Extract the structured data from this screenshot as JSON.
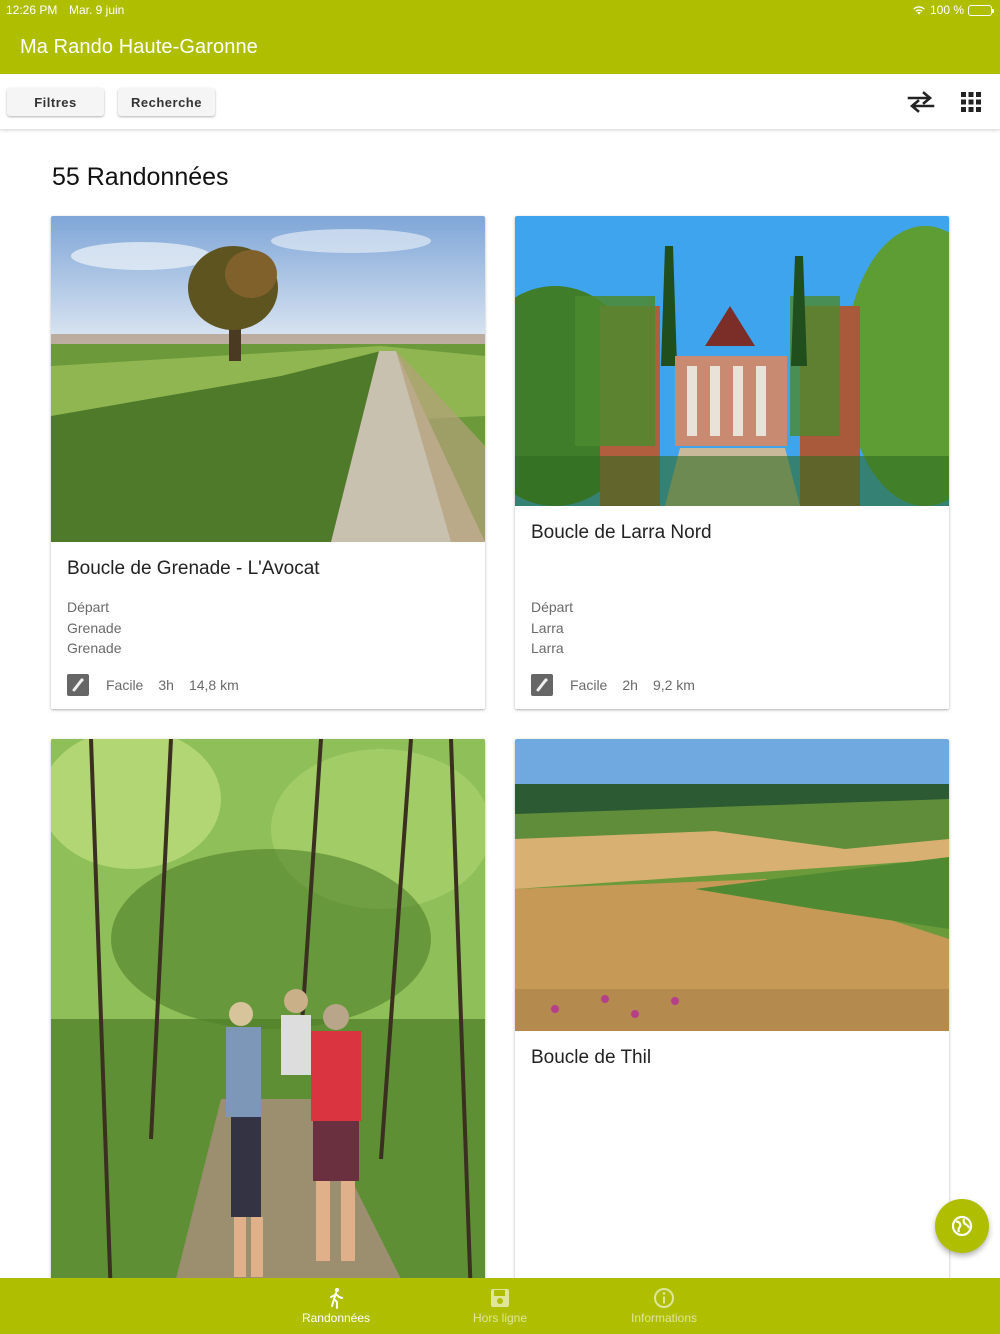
{
  "status_bar": {
    "time": "12:26 PM",
    "date": "Mar. 9 juin",
    "battery": "100 %"
  },
  "app": {
    "title": "Ma Rando Haute-Garonne"
  },
  "toolbar": {
    "filters_label": "Filtres",
    "search_label": "Recherche"
  },
  "main": {
    "result_count_text": "55 Randonnées",
    "cards": [
      {
        "title": "Boucle de Grenade - L'Avocat",
        "depart_label": "Départ",
        "depart_line1": "Grenade",
        "depart_line2": "Grenade",
        "difficulty": "Facile",
        "duration": "3h",
        "distance": "14,8 km"
      },
      {
        "title": "Boucle de Larra Nord",
        "depart_label": "Départ",
        "depart_line1": "Larra",
        "depart_line2": "Larra",
        "difficulty": "Facile",
        "duration": "2h",
        "distance": "9,2 km"
      },
      {
        "title": ""
      },
      {
        "title": "Boucle de Thil"
      }
    ]
  },
  "bottom_nav": {
    "items": [
      {
        "label": "Randonnées",
        "icon": "walker-icon",
        "active": true
      },
      {
        "label": "Hors ligne",
        "icon": "save-icon",
        "active": false
      },
      {
        "label": "Informations",
        "icon": "info-icon",
        "active": false
      }
    ]
  },
  "colors": {
    "brand": "#afbf00"
  }
}
